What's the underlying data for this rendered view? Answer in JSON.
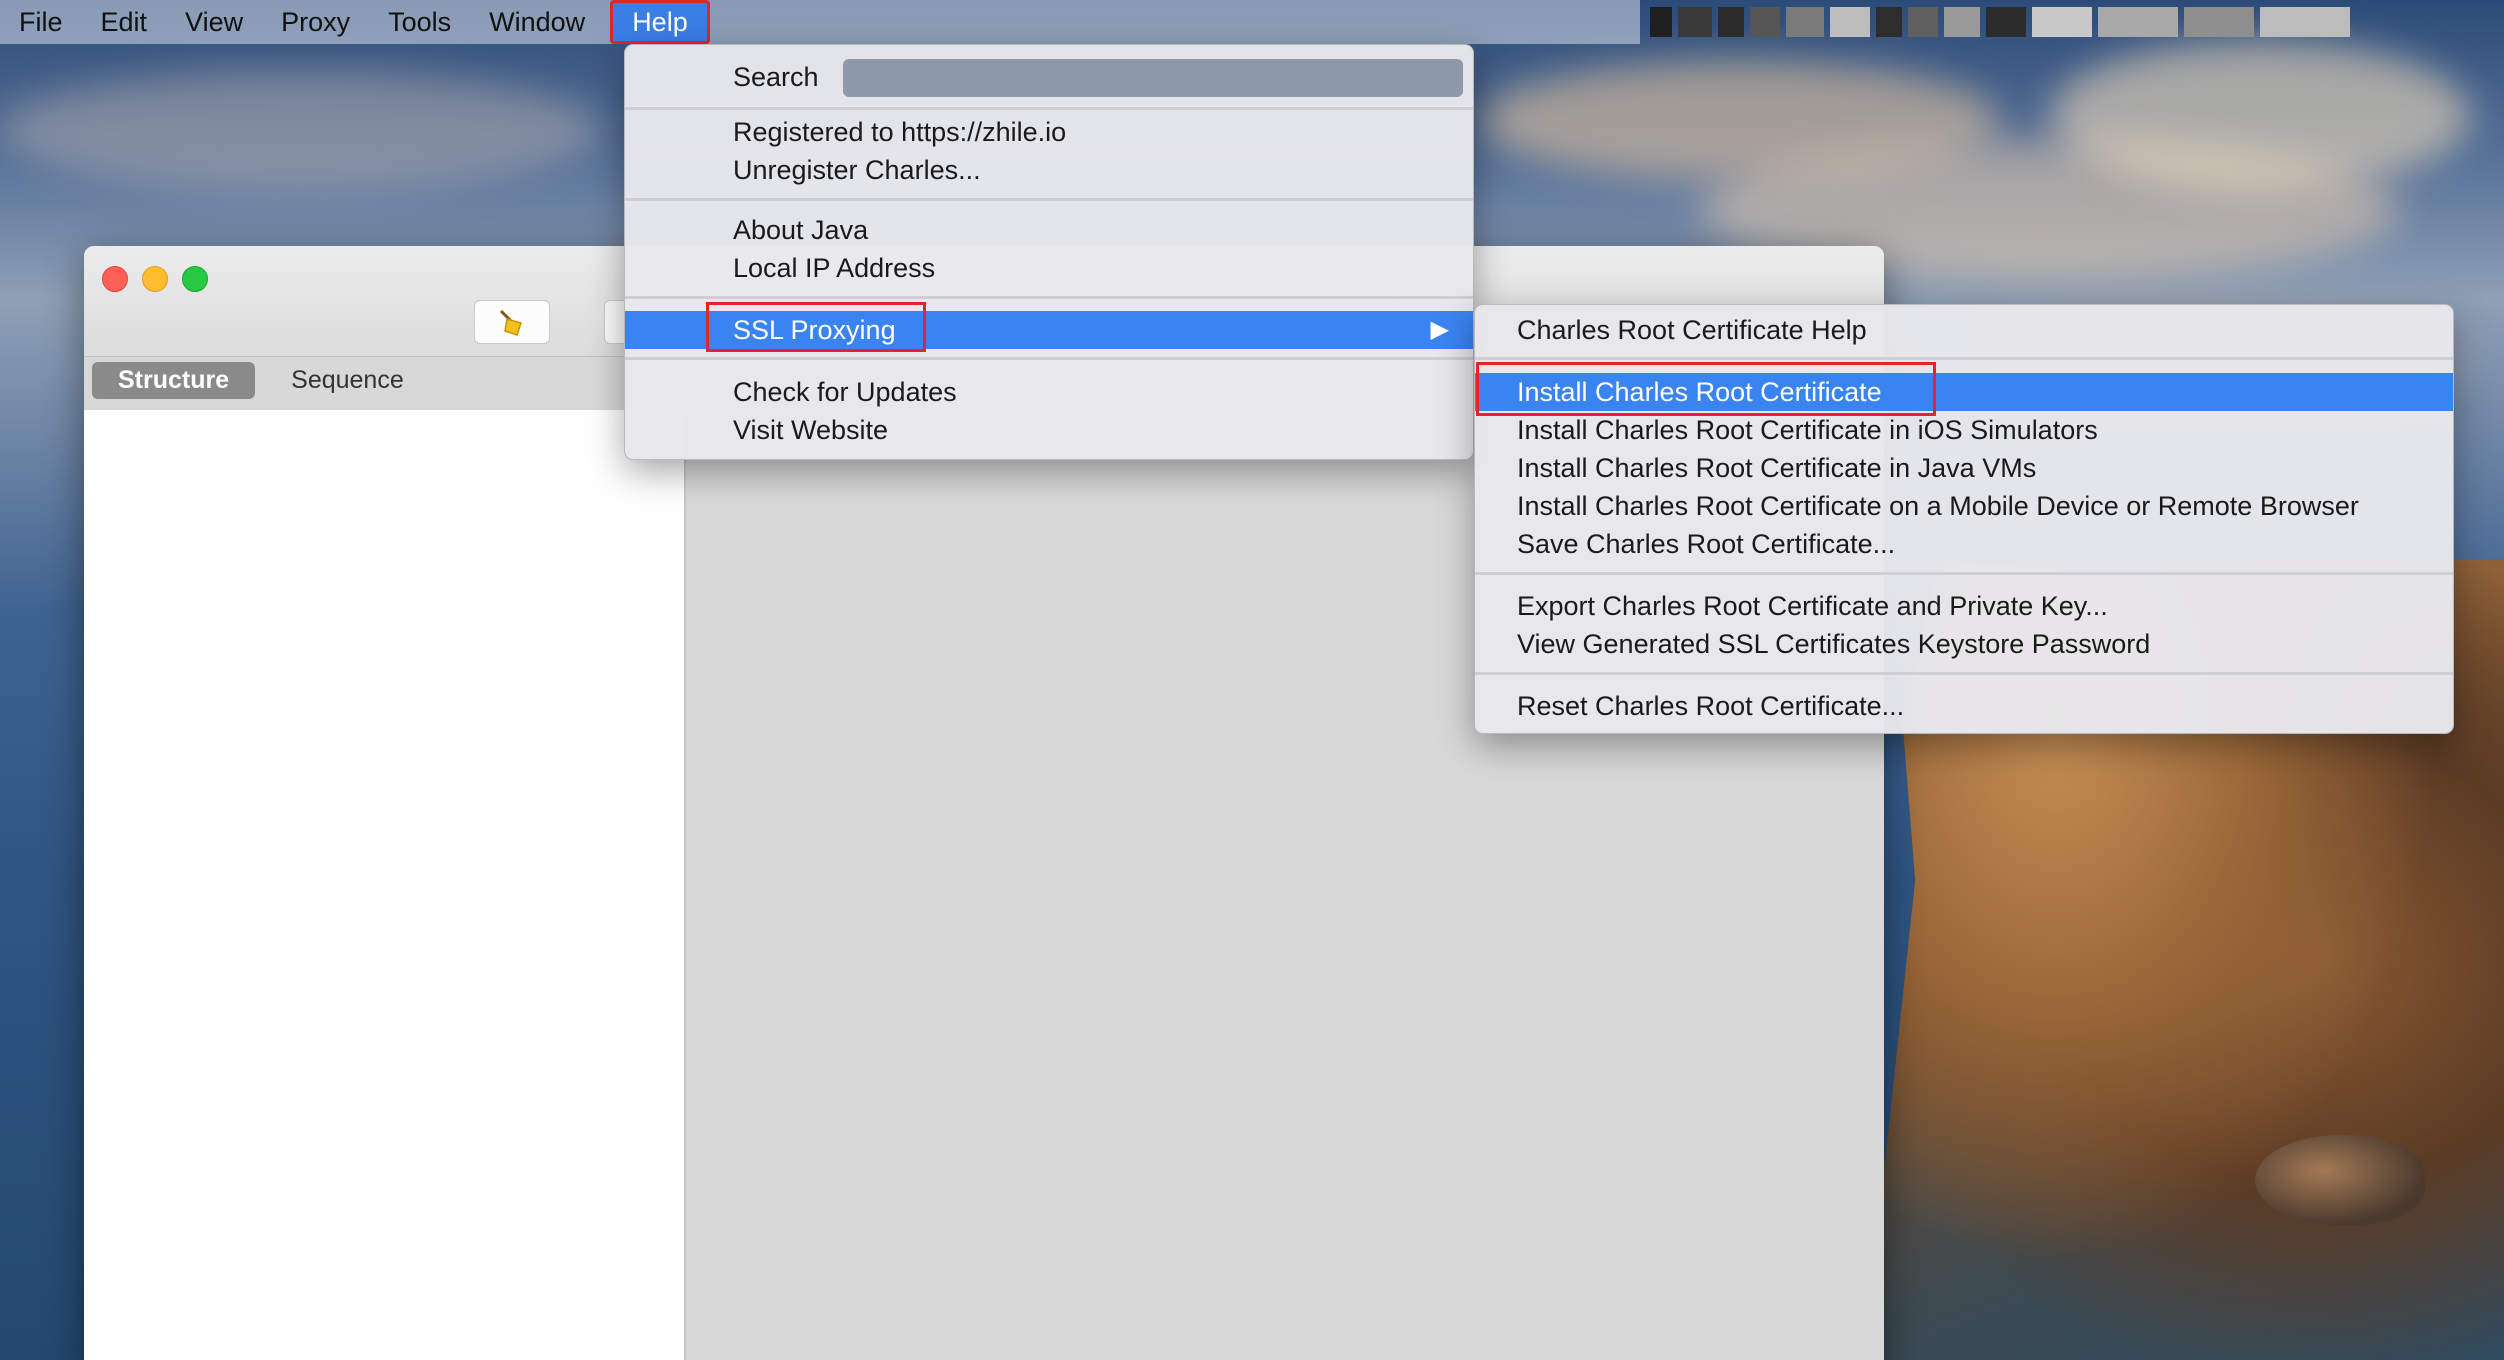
{
  "menubar": {
    "items": [
      "File",
      "Edit",
      "View",
      "Proxy",
      "Tools",
      "Window",
      "Help"
    ],
    "active": "Help"
  },
  "window": {
    "tabs": [
      "Structure",
      "Sequence"
    ],
    "selected_tab": "Structure"
  },
  "help_menu": {
    "search_label": "Search",
    "search_value": "",
    "registered": "Registered to https://zhile.io",
    "unregister": "Unregister Charles...",
    "about_java": "About Java",
    "local_ip": "Local IP Address",
    "ssl_proxying": "SSL Proxying",
    "check_updates": "Check for Updates",
    "visit_website": "Visit Website"
  },
  "ssl_submenu": {
    "help": "Charles Root Certificate Help",
    "install": "Install Charles Root Certificate",
    "install_ios": "Install Charles Root Certificate in iOS Simulators",
    "install_java": "Install Charles Root Certificate in Java VMs",
    "install_mobile": "Install Charles Root Certificate on a Mobile Device or Remote Browser",
    "save": "Save Charles Root Certificate...",
    "export": "Export Charles Root Certificate and Private Key...",
    "view_keystore": "View Generated SSL Certificates Keystore Password",
    "reset": "Reset Charles Root Certificate..."
  },
  "colors": {
    "highlight": "#3a84f2",
    "annotation_box": "#e0262a"
  },
  "icons": [
    "broom-icon",
    "submenu-arrow-icon",
    "close-window-icon",
    "minimize-window-icon",
    "zoom-window-icon"
  ]
}
